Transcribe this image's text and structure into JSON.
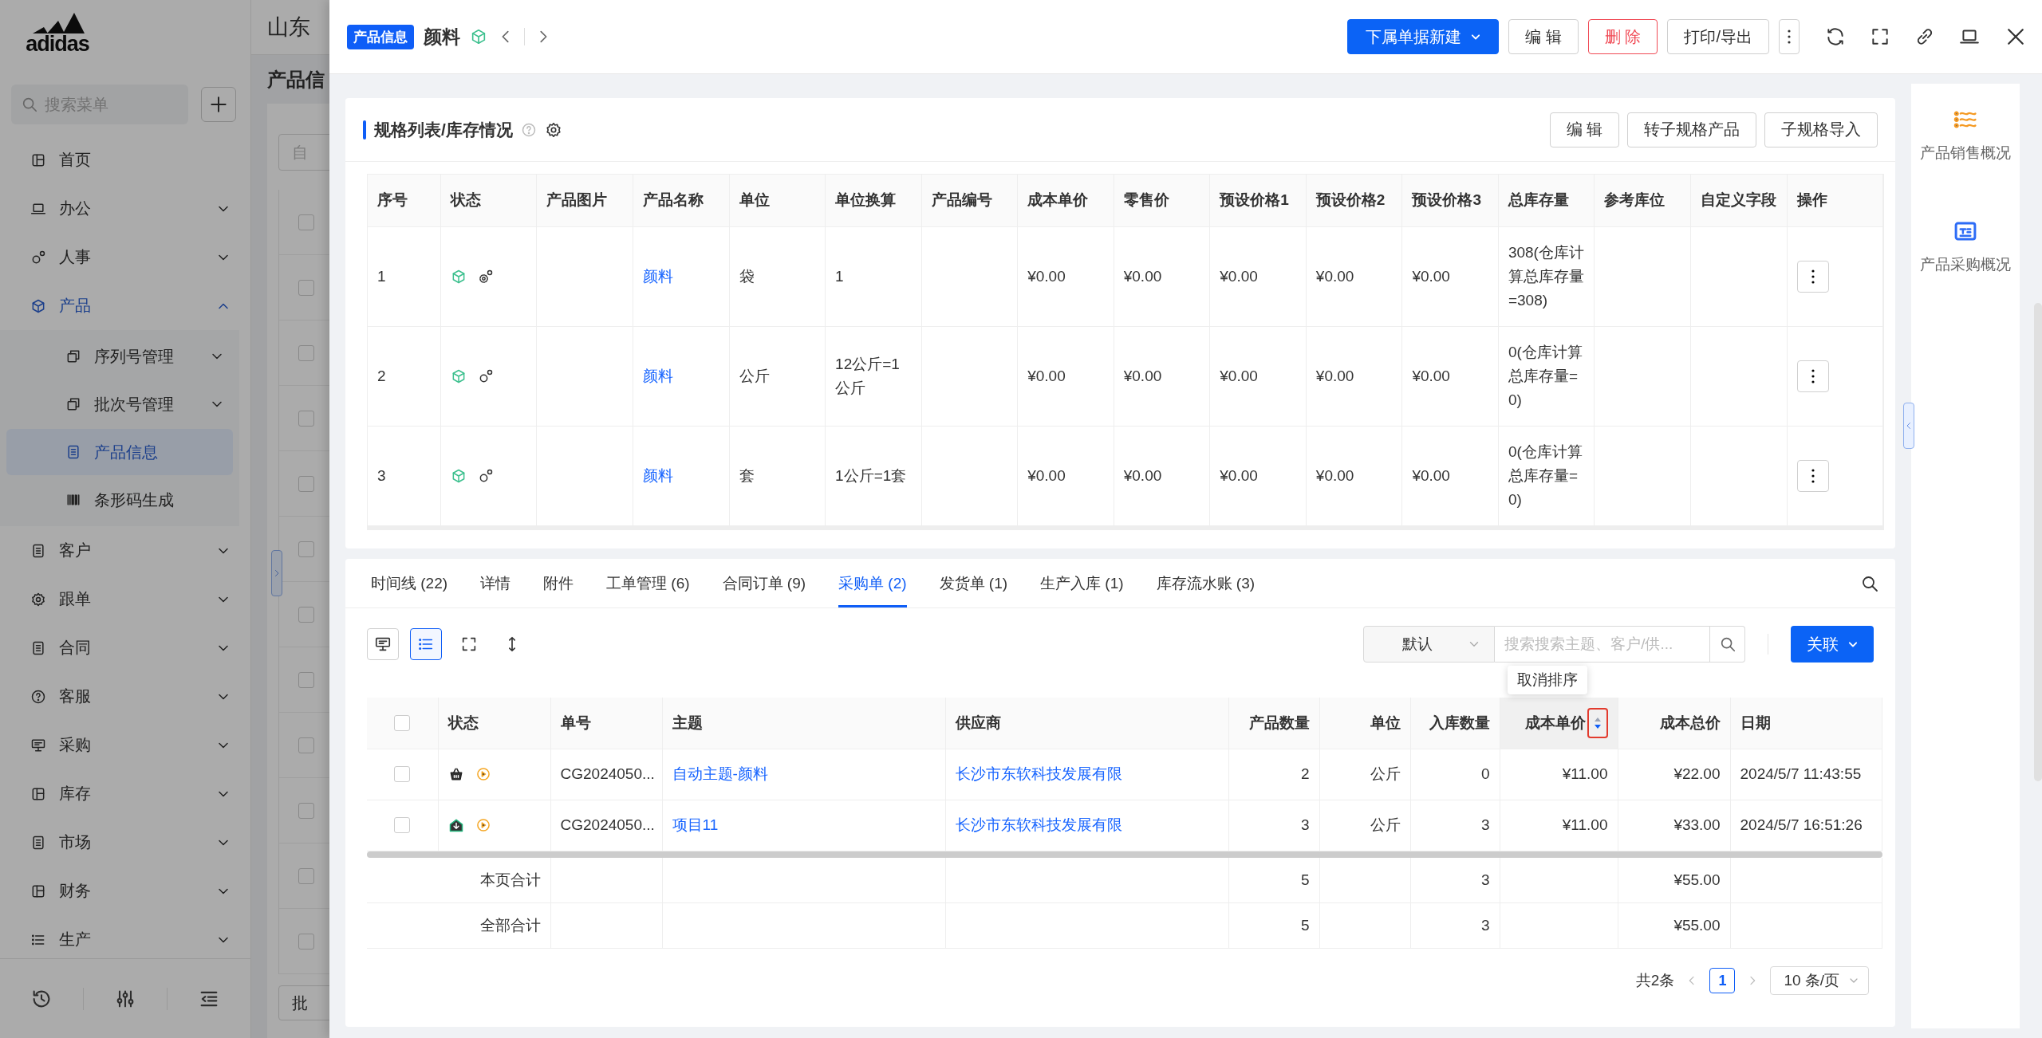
{
  "sidebar": {
    "logo_text": "adidas",
    "search_placeholder": "搜索菜单",
    "items": [
      {
        "label": "首页",
        "selected": false
      },
      {
        "label": "办公",
        "expanded": false,
        "selected": false
      },
      {
        "label": "人事",
        "expanded": false,
        "selected": false
      },
      {
        "label": "产品",
        "expanded": true,
        "selected": true,
        "children": [
          {
            "label": "序列号管理",
            "expanded": false,
            "selected": false
          },
          {
            "label": "批次号管理",
            "expanded": false,
            "selected": false
          },
          {
            "label": "产品信息",
            "selected": true
          },
          {
            "label": "条形码生成",
            "selected": false
          }
        ]
      },
      {
        "label": "客户",
        "expanded": false,
        "selected": false
      },
      {
        "label": "跟单",
        "expanded": false,
        "selected": false
      },
      {
        "label": "合同",
        "expanded": false,
        "selected": false
      },
      {
        "label": "客服",
        "expanded": false,
        "selected": false
      },
      {
        "label": "采购",
        "expanded": false,
        "selected": false
      },
      {
        "label": "库存",
        "expanded": false,
        "selected": false
      },
      {
        "label": "市场",
        "expanded": false,
        "selected": false
      },
      {
        "label": "财务",
        "expanded": false,
        "selected": false
      },
      {
        "label": "生产",
        "expanded": false,
        "selected": false
      }
    ]
  },
  "background_page": {
    "company": "山东",
    "title": "产品信",
    "filter": "自",
    "button": "批",
    "rows": [
      {
        "checked": false
      },
      {
        "checked": false
      },
      {
        "checked": false
      },
      {
        "checked": false
      },
      {
        "checked": false
      },
      {
        "checked": false
      },
      {
        "checked": false
      },
      {
        "checked": false
      },
      {
        "checked": false
      },
      {
        "checked": false
      },
      {
        "checked": false
      },
      {
        "checked": false
      }
    ]
  },
  "drawer": {
    "badge": "产品信息",
    "title": "颜料",
    "actions": [
      {
        "label": "下属单据新建",
        "kind": "primary"
      },
      {
        "label": "编 辑",
        "kind": "default"
      },
      {
        "label": "删 除",
        "kind": "danger"
      },
      {
        "label": "打印/导出",
        "kind": "default"
      }
    ]
  },
  "spec_card": {
    "title": "规格列表/库存情况",
    "buttons": [
      "编 辑",
      "转子规格产品",
      "子规格导入"
    ],
    "columns": [
      "序号",
      "状态",
      "产品图片",
      "产品名称",
      "单位",
      "单位换算",
      "产品编号",
      "成本单价",
      "零售价",
      "预设价格1",
      "预设价格2",
      "预设价格3",
      "总库存量",
      "参考库位",
      "自定义字段",
      "操作"
    ],
    "rows": [
      {
        "number": "1",
        "name": "颜料",
        "unit": "袋",
        "conversion": "1",
        "cost_price": "¥0.00",
        "retail_price": "¥0.00",
        "preset_prices": [
          "¥0.00",
          "¥0.00",
          "¥0.00"
        ],
        "stock": "308(仓库计算总库存量=308)"
      },
      {
        "number": "2",
        "name": "颜料",
        "unit": "公斤",
        "conversion": "12公斤=1公斤",
        "cost_price": "¥0.00",
        "retail_price": "¥0.00",
        "preset_prices": [
          "¥0.00",
          "¥0.00",
          "¥0.00"
        ],
        "stock": "0(仓库计算总库存量=0)"
      },
      {
        "number": "3",
        "name": "颜料",
        "unit": "套",
        "conversion": "1公斤=1套",
        "cost_price": "¥0.00",
        "retail_price": "¥0.00",
        "preset_prices": [
          "¥0.00",
          "¥0.00",
          "¥0.00"
        ],
        "stock": "0(仓库计算总库存量=0)"
      }
    ]
  },
  "orders_card": {
    "tabs": [
      {
        "label": "时间线 (22)",
        "selected": false
      },
      {
        "label": "详情",
        "selected": false
      },
      {
        "label": "附件",
        "selected": false
      },
      {
        "label": "工单管理 (6)",
        "selected": false
      },
      {
        "label": "合同订单 (9)",
        "selected": false
      },
      {
        "label": "采购单 (2)",
        "selected": true
      },
      {
        "label": "发货单 (1)",
        "selected": false
      },
      {
        "label": "生产入库 (1)",
        "selected": false
      },
      {
        "label": "库存流水账 (3)",
        "selected": false
      }
    ],
    "view_buttons": [
      {
        "selected": false
      },
      {
        "selected": true
      },
      {
        "selected": false
      },
      {
        "selected": false
      }
    ],
    "sort_select": "默认",
    "search_placeholder": "搜索搜索主题、客户/供...",
    "link_button": "关联",
    "tooltip": "取消排序",
    "select_all_checked": false,
    "columns": [
      {
        "label": "状态",
        "sorted": false
      },
      {
        "label": "单号",
        "sorted": false
      },
      {
        "label": "主题",
        "sorted": false
      },
      {
        "label": "供应商",
        "sorted": false
      },
      {
        "label": "产品数量",
        "sorted": false
      },
      {
        "label": "单位",
        "sorted": false
      },
      {
        "label": "入库数量",
        "sorted": false
      },
      {
        "label": "成本单价",
        "sorted": true
      },
      {
        "label": "成本总价",
        "sorted": false
      },
      {
        "label": "日期",
        "sorted": false
      }
    ],
    "rows": [
      {
        "checked": false,
        "kind": "basket",
        "number": "CG2024050...",
        "subject": "自动主题-颜料",
        "supplier": "长沙市东软科技发展有限",
        "quantity": "2",
        "unit": "公斤",
        "received": "0",
        "unit_cost": "¥11.00",
        "total_cost": "¥22.00",
        "date": "2024/5/7 11:43:55"
      },
      {
        "checked": false,
        "kind": "inbound",
        "number": "CG2024050...",
        "subject": "项目11",
        "supplier": "长沙市东软科技发展有限",
        "quantity": "3",
        "unit": "公斤",
        "received": "3",
        "unit_cost": "¥11.00",
        "total_cost": "¥33.00",
        "date": "2024/5/7 16:51:26"
      }
    ],
    "totals": [
      {
        "label": "本页合计",
        "quantity": "5",
        "received": "3",
        "total_cost": "¥55.00"
      },
      {
        "label": "全部合计",
        "quantity": "5",
        "received": "3",
        "total_cost": "¥55.00"
      }
    ],
    "pagination": {
      "total": "共2条",
      "pages": [
        {
          "label": "1",
          "selected": true
        }
      ],
      "page_size": "10 条/页"
    }
  },
  "side_panel": {
    "items": [
      {
        "label": "产品销售概况",
        "kind": "sales"
      },
      {
        "label": "产品采购概况",
        "kind": "purchase"
      }
    ]
  }
}
